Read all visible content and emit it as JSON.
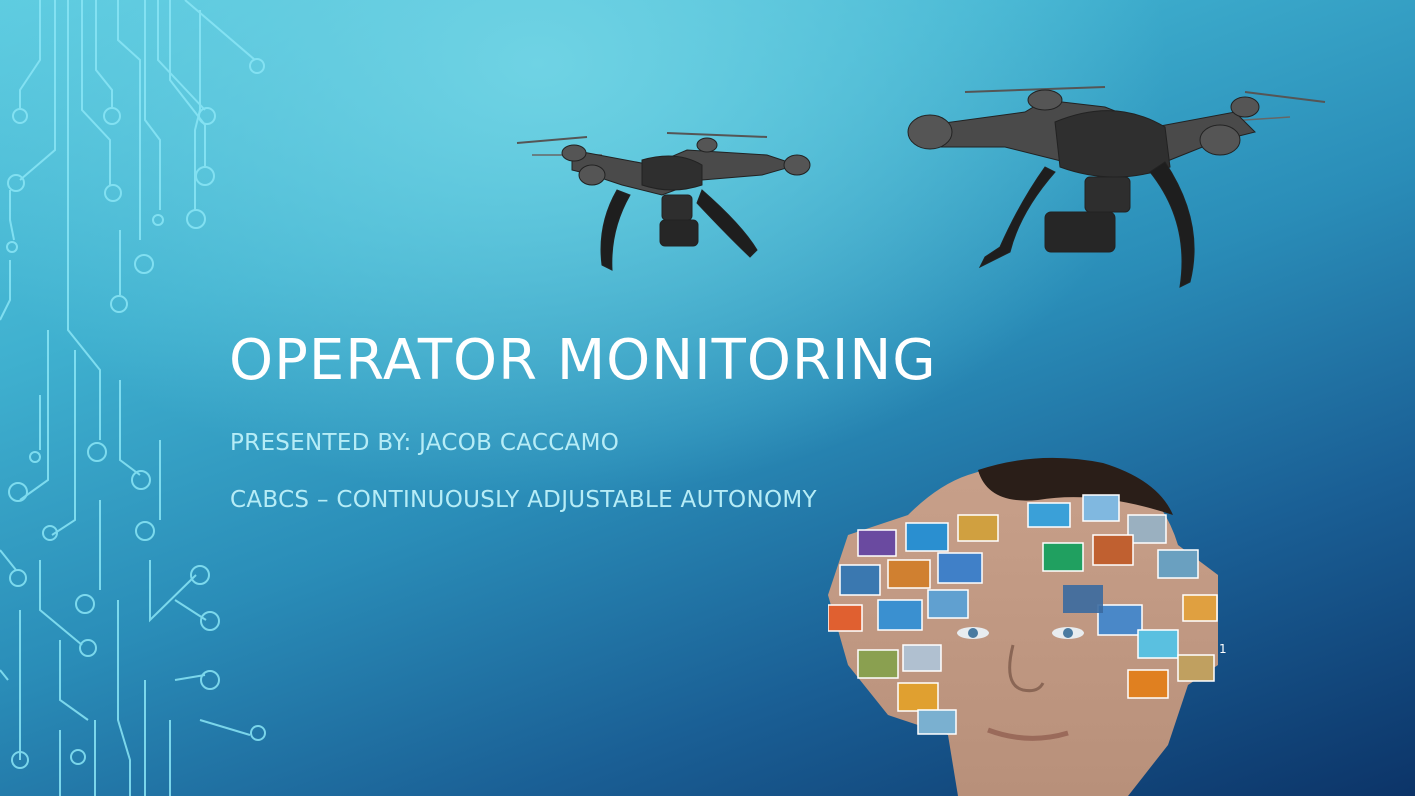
{
  "slide": {
    "title": "OPERATOR MONITORING",
    "subtitle_presenter": "PRESENTED BY: JACOB CACCAMO",
    "subtitle_project": "CABCS – CONTINUOUSLY ADJUSTABLE AUTONOMY",
    "slide_number": "1"
  },
  "colors": {
    "background_top": "#5ccbe0",
    "background_bottom": "#0c3468",
    "title": "#ffffff",
    "subtitle": "#b6ecf6",
    "circuit_lines": "#7fe3f5"
  },
  "images": {
    "drone_left": "quadcopter-drone-icon",
    "drone_right": "quadcopter-drone-icon",
    "person_head": "person-head-with-media-tiles-image"
  }
}
